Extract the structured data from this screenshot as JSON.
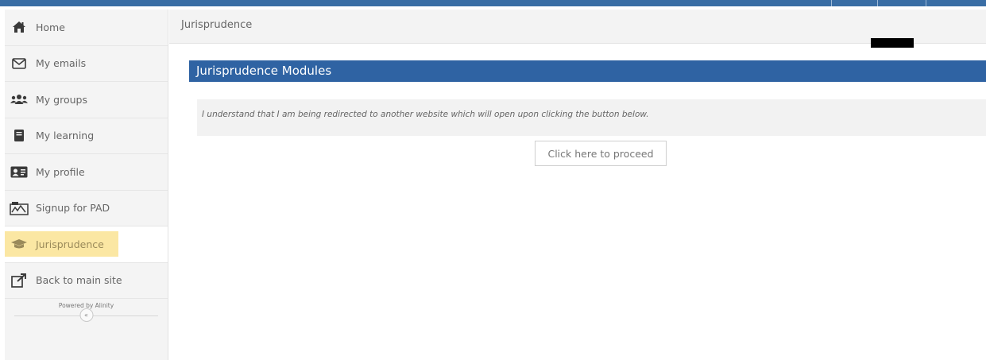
{
  "colors": {
    "accent": "#2f63a3",
    "active_highlight": "#fbe7a3",
    "redaction": "#000000"
  },
  "sidebar": {
    "items": [
      {
        "label": "Home",
        "icon": "home-icon"
      },
      {
        "label": "My emails",
        "icon": "envelope-icon"
      },
      {
        "label": "My groups",
        "icon": "users-icon"
      },
      {
        "label": "My learning",
        "icon": "book-icon"
      },
      {
        "label": "My profile",
        "icon": "id-card-icon"
      },
      {
        "label": "Signup for PAD",
        "icon": "signup-icon"
      },
      {
        "label": "Jurisprudence",
        "icon": "graduation-cap-icon",
        "active": true
      },
      {
        "label": "Back to main site",
        "icon": "external-link-icon"
      }
    ],
    "powered_by": "Powered by Alinity",
    "collapse_label": "«"
  },
  "breadcrumb": {
    "current": "Jurisprudence"
  },
  "main": {
    "panel_title": "Jurisprudence Modules",
    "notice": "I understand that I am being redirected to another website which will open upon clicking the button below.",
    "proceed_button": "Click here to proceed"
  }
}
